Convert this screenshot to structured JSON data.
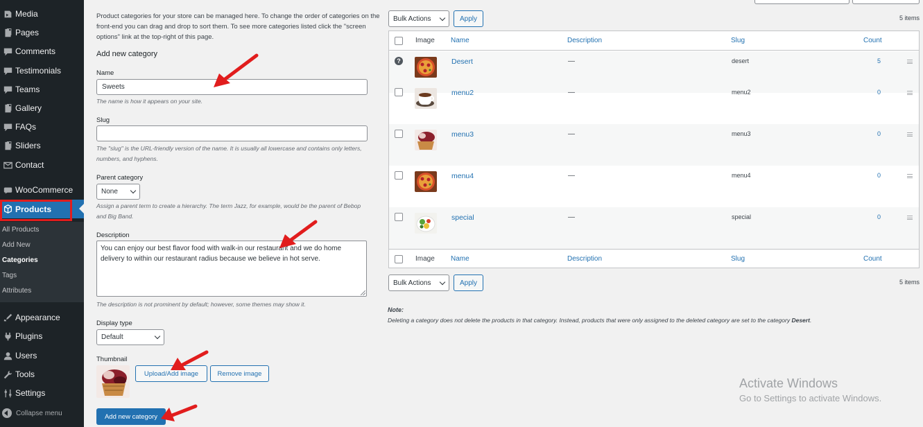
{
  "sidebar": {
    "items": [
      {
        "label": "Media",
        "icon": "media-icon"
      },
      {
        "label": "Pages",
        "icon": "pages-icon"
      },
      {
        "label": "Comments",
        "icon": "comments-icon"
      },
      {
        "label": "Testimonials",
        "icon": "testimonials-icon"
      },
      {
        "label": "Teams",
        "icon": "teams-icon"
      },
      {
        "label": "Gallery",
        "icon": "gallery-icon"
      },
      {
        "label": "FAQs",
        "icon": "faqs-icon"
      },
      {
        "label": "Sliders",
        "icon": "sliders-icon"
      },
      {
        "label": "Contact",
        "icon": "contact-icon"
      },
      {
        "label": "WooCommerce",
        "icon": "woocommerce-icon"
      },
      {
        "label": "Products",
        "icon": "products-icon"
      },
      {
        "label": "Appearance",
        "icon": "appearance-icon"
      },
      {
        "label": "Plugins",
        "icon": "plugins-icon"
      },
      {
        "label": "Users",
        "icon": "users-icon"
      },
      {
        "label": "Tools",
        "icon": "tools-icon"
      },
      {
        "label": "Settings",
        "icon": "settings-icon"
      }
    ],
    "submenu": [
      "All Products",
      "Add New",
      "Categories",
      "Tags",
      "Attributes"
    ],
    "collapse_label": "Collapse menu",
    "accent_color": "#2271b1",
    "highlight_color": "#e11d1d"
  },
  "form": {
    "intro": "Product categories for your store can be managed here. To change the order of categories on the front-end you can drag and drop to sort them. To see more categories listed click the \"screen options\" link at the top-right of this page.",
    "heading": "Add new category",
    "name_label": "Name",
    "name_value": "Sweets",
    "name_help": "The name is how it appears on your site.",
    "slug_label": "Slug",
    "slug_value": "",
    "slug_help": "The \"slug\" is the URL-friendly version of the name. It is usually all lowercase and contains only letters, numbers, and hyphens.",
    "parent_label": "Parent category",
    "parent_value": "None",
    "parent_help": "Assign a parent term to create a hierarchy. The term Jazz, for example, would be the parent of Bebop and Big Band.",
    "description_label": "Description",
    "description_value": "You can enjoy our best flavor food with walk-in our restaurant and we do home delivery to within our restaurant radius because we believe in hot serve.",
    "description_help": "The description is not prominent by default; however, some themes may show it.",
    "display_label": "Display type",
    "display_value": "Default",
    "thumbnail_label": "Thumbnail",
    "upload_button": "Upload/Add image",
    "remove_button": "Remove image",
    "submit_button": "Add new category"
  },
  "table": {
    "bulk_actions": "Bulk Actions",
    "apply": "Apply",
    "items_count": "5 items",
    "columns": {
      "image": "Image",
      "name": "Name",
      "description": "Description",
      "slug": "Slug",
      "count": "Count"
    },
    "rows": [
      {
        "name": "Desert",
        "description": "—",
        "slug": "desert",
        "count": "5",
        "image": "pizza",
        "default": true
      },
      {
        "name": "menu2",
        "description": "—",
        "slug": "menu2",
        "count": "0",
        "image": "coffee",
        "default": false
      },
      {
        "name": "menu3",
        "description": "—",
        "slug": "menu3",
        "count": "0",
        "image": "dessert",
        "default": false
      },
      {
        "name": "menu4",
        "description": "—",
        "slug": "menu4",
        "count": "0",
        "image": "pizza",
        "default": false
      },
      {
        "name": "special",
        "description": "—",
        "slug": "special",
        "count": "0",
        "image": "salad",
        "default": false
      }
    ],
    "default_badge": "?"
  },
  "note": {
    "title": "Note:",
    "text_prefix": "Deleting a category does not delete the products in that category. Instead, products that were only assigned to the deleted category are set to the category ",
    "text_strong": "Desert",
    "text_suffix": "."
  },
  "watermark": {
    "line1": "Activate Windows",
    "line2": "Go to Settings to activate Windows."
  }
}
